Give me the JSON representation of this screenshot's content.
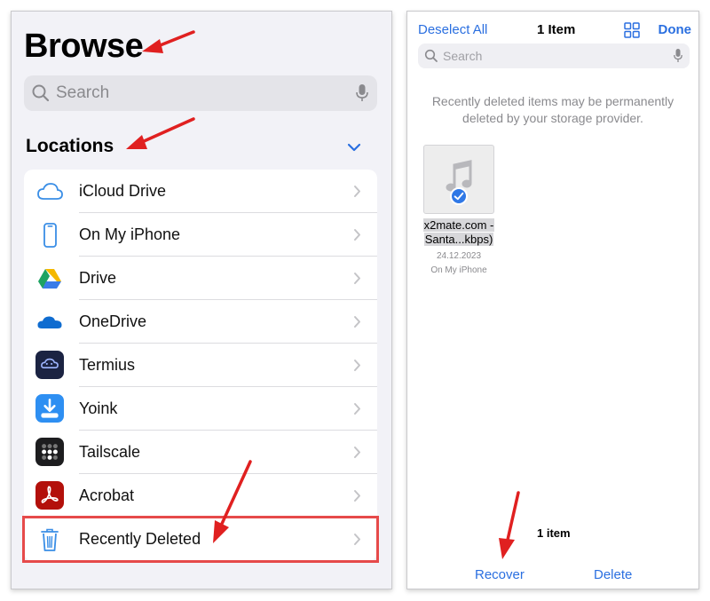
{
  "left": {
    "title": "Browse",
    "search_placeholder": "Search",
    "locations_label": "Locations",
    "items": [
      {
        "label": "iCloud Drive",
        "icon": "cloud-icon"
      },
      {
        "label": "On My iPhone",
        "icon": "iphone-icon"
      },
      {
        "label": "Drive",
        "icon": "google-drive-icon"
      },
      {
        "label": "OneDrive",
        "icon": "onedrive-icon"
      },
      {
        "label": "Termius",
        "icon": "termius-app-icon"
      },
      {
        "label": "Yoink",
        "icon": "yoink-app-icon"
      },
      {
        "label": "Tailscale",
        "icon": "tailscale-app-icon"
      },
      {
        "label": "Acrobat",
        "icon": "acrobat-app-icon"
      },
      {
        "label": "Recently Deleted",
        "icon": "trash-icon"
      }
    ]
  },
  "right": {
    "deselect_label": "Deselect All",
    "title": "1 Item",
    "done_label": "Done",
    "search_placeholder": "Search",
    "notice": "Recently deleted items may be permanently deleted by your storage provider.",
    "file": {
      "name_line1": "x2mate.com -",
      "name_line2": "Santa...kbps)",
      "date": "24.12.2023",
      "location": "On My iPhone",
      "icon": "music-note-icon"
    },
    "selection_count": "1 item",
    "recover_label": "Recover",
    "delete_label": "Delete"
  },
  "colors": {
    "accent": "#2a6fe0",
    "highlight": "#e64a4a",
    "arrow": "#e02020"
  }
}
